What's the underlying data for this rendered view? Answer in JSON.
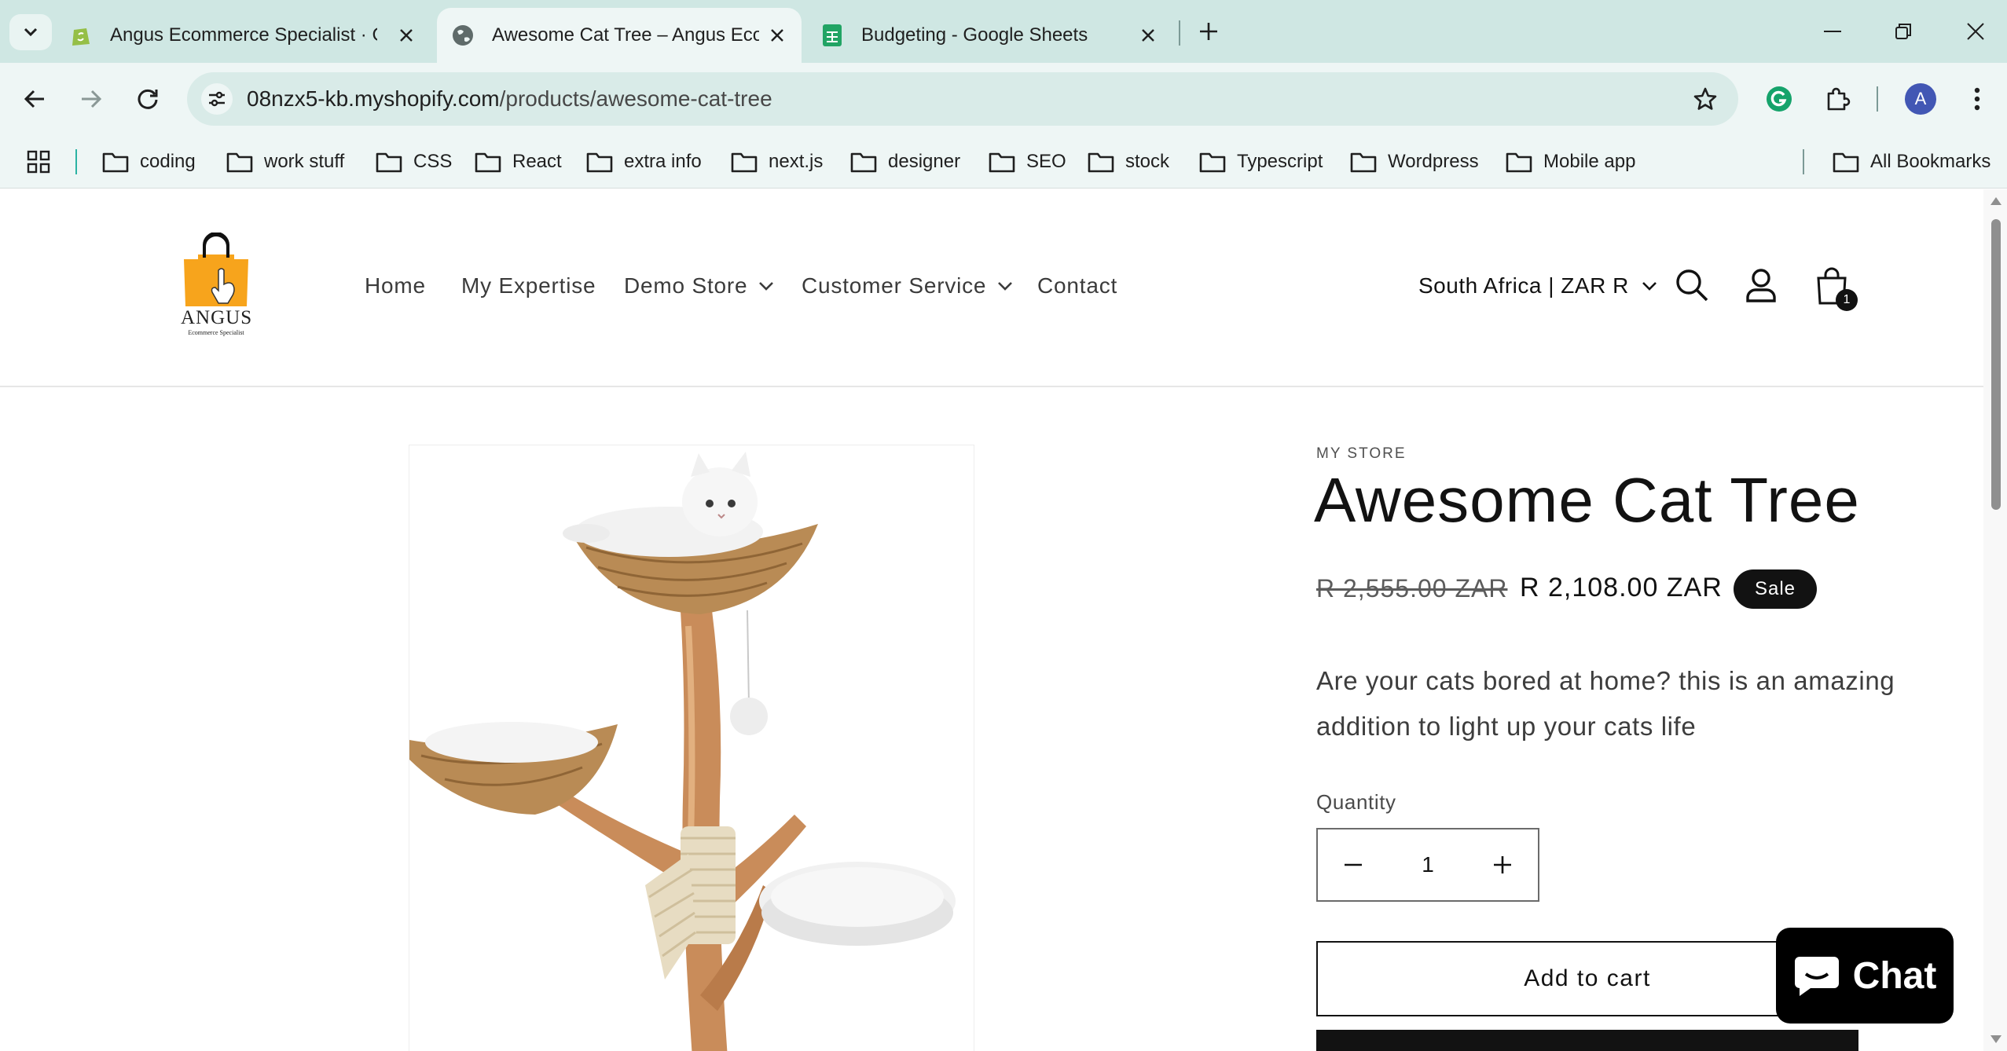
{
  "browser": {
    "tabs": [
      {
        "title": "Angus Ecommerce Specialist · C",
        "active": false,
        "icon": "shopify-icon"
      },
      {
        "title": "Awesome Cat Tree – Angus Eco",
        "active": true,
        "icon": "globe-icon"
      },
      {
        "title": "Budgeting - Google Sheets",
        "active": false,
        "icon": "sheets-icon"
      }
    ],
    "url_host": "08nzx5-kb.myshopify.com",
    "url_path": "/products/awesome-cat-tree",
    "profile_initial": "A",
    "bookmarks": [
      "coding",
      "work stuff",
      "CSS",
      "React",
      "extra info",
      "next.js",
      "designer",
      "SEO",
      "stock",
      "Typescript",
      "Wordpress",
      "Mobile app"
    ],
    "all_bookmarks": "All Bookmarks",
    "colors": {
      "tabbar": "#cfe7e3",
      "toolbar": "#eef6f5",
      "omnibox": "#d9ebe8",
      "avatar": "#4257b4"
    }
  },
  "store": {
    "logo_word": "ANGUS",
    "logo_sub": "Ecommerce Specialist",
    "menu": [
      {
        "label": "Home",
        "has_dropdown": false
      },
      {
        "label": "My Expertise",
        "has_dropdown": false
      },
      {
        "label": "Demo Store",
        "has_dropdown": true
      },
      {
        "label": "Customer Service",
        "has_dropdown": true
      },
      {
        "label": "Contact",
        "has_dropdown": false
      }
    ],
    "region": "South Africa | ZAR R",
    "cart_count": "1"
  },
  "product": {
    "vendor": "MY STORE",
    "title": "Awesome Cat Tree",
    "compare_price": "R 2,555.00 ZAR",
    "price": "R 2,108.00 ZAR",
    "badge": "Sale",
    "description": "Are your cats bored at home? this is an amazing addition to light up your cats life",
    "quantity_label": "Quantity",
    "quantity": "1",
    "add_to_cart": "Add to cart"
  },
  "chat": {
    "label": "Chat"
  }
}
